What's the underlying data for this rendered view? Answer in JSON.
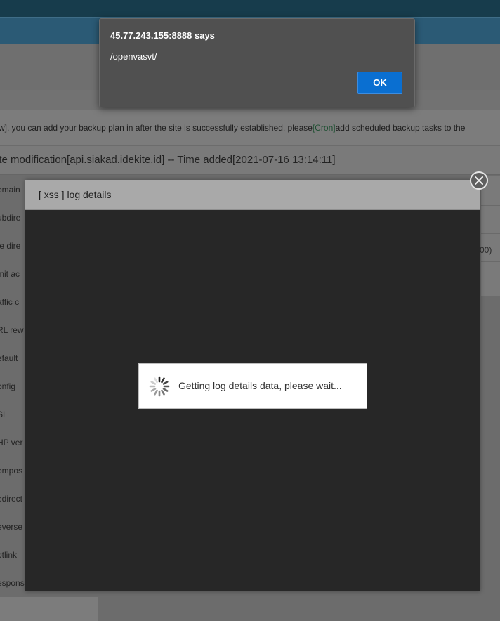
{
  "background_page": {
    "notice": {
      "text_before": "w], you can add your backup plan in after the site is successfully established, please",
      "link": "[Cron]",
      "text_after": "add scheduled backup tasks to the"
    },
    "panel_title": "ite modification[api.siakad.idekite.id] -- Time added[2021-07-16 13:14:11]",
    "left_menu": [
      "omain",
      "ubdire",
      "te dire",
      "mit ac",
      "affic c",
      "RL rew",
      "efault",
      "onfig",
      "SL",
      "HP ver",
      "ompos",
      "edirect",
      "everse",
      "otlink",
      "espons"
    ],
    "right_snippet": "00)"
  },
  "layer": {
    "title": "[ xss ] log details",
    "loading_text": "Getting log details data, please wait..."
  },
  "alert": {
    "origin": "45.77.243.155:8888 says",
    "message": "/openvasvt/",
    "ok_label": "OK"
  },
  "colors": {
    "alert_bg": "#505050",
    "ok_button": "#0a6fd1",
    "layer_body": "#272727",
    "layer_header": "#a9a9a9",
    "cron_link": "#1d4f31"
  },
  "icons": {
    "close": "close-icon",
    "spinner": "loading-spinner-icon"
  }
}
